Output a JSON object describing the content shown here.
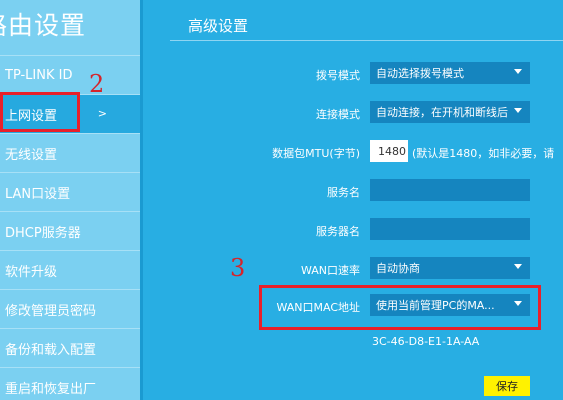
{
  "sidebar": {
    "title": "路由设置",
    "items": [
      {
        "label": "TP-LINK ID"
      },
      {
        "label": "上网设置",
        "chevron": ">"
      },
      {
        "label": "无线设置"
      },
      {
        "label": "LAN口设置"
      },
      {
        "label": "DHCP服务器"
      },
      {
        "label": "软件升级"
      },
      {
        "label": "修改管理员密码"
      },
      {
        "label": "备份和载入配置"
      },
      {
        "label": "重启和恢复出厂"
      }
    ]
  },
  "annotations": {
    "step2": "2",
    "step3": "3"
  },
  "main": {
    "title": "高级设置",
    "dial_mode": {
      "label": "拨号模式",
      "value": "自动选择拨号模式"
    },
    "connect_mode": {
      "label": "连接模式",
      "value": "自动连接，在开机和断线后"
    },
    "mtu": {
      "label": "数据包MTU(字节)",
      "value": "1480",
      "hint": "(默认是1480，如非必要，请"
    },
    "service_name": {
      "label": "服务名",
      "value": ""
    },
    "server_name": {
      "label": "服务器名",
      "value": ""
    },
    "wan_speed": {
      "label": "WAN口速率",
      "value": "自动协商"
    },
    "wan_mac": {
      "label": "WAN口MAC地址",
      "value": "使用当前管理PC的MA...",
      "mac": "3C-46-D8-E1-1A-AA"
    },
    "save_label": "保存"
  }
}
